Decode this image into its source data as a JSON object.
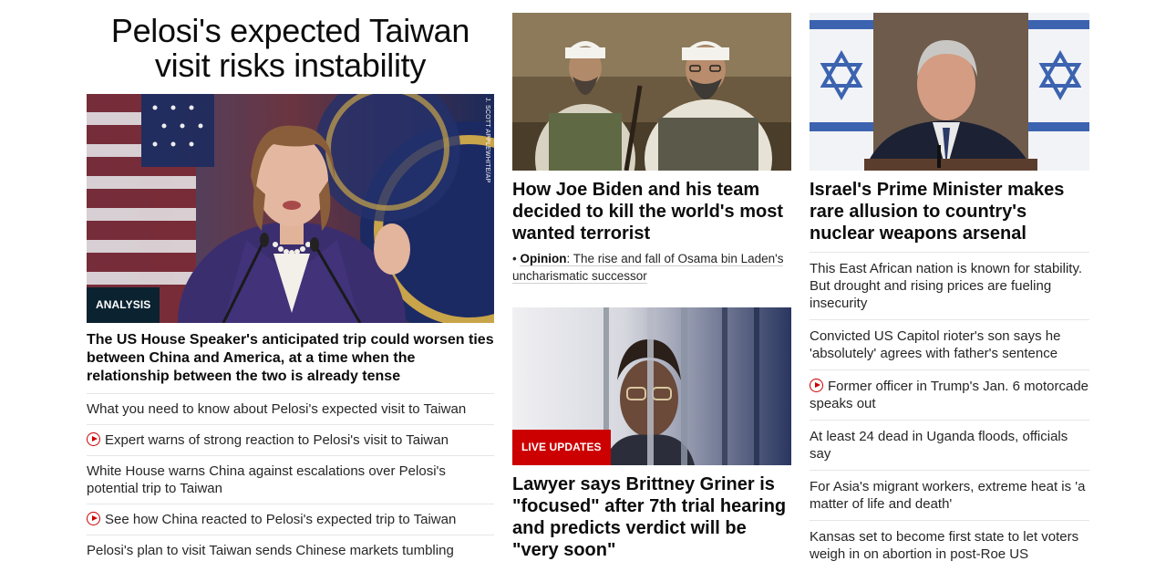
{
  "left": {
    "headline": "Pelosi's expected Taiwan visit risks instability",
    "badge": "ANALYSIS",
    "photo_credit": "J. SCOTT APPLEWHITE/AP",
    "summary": "The US House Speaker's anticipated trip could worsen ties between China and America, at a time when the relationship between the two is already tense",
    "links": [
      {
        "text": "What you need to know about Pelosi's expected visit to Taiwan",
        "video": false
      },
      {
        "text": "Expert warns of strong reaction to Pelosi's visit to Taiwan",
        "video": true
      },
      {
        "text": "White House warns China against escalations over Pelosi's potential trip to Taiwan",
        "video": false
      },
      {
        "text": "See how China reacted to Pelosi's expected trip to Taiwan",
        "video": true
      },
      {
        "text": "Pelosi's plan to visit Taiwan sends Chinese markets tumbling",
        "video": false
      }
    ]
  },
  "middle": {
    "story1": {
      "headline": "How Joe Biden and his team decided to kill the world's most wanted terrorist",
      "opinion_tag": "Opinion",
      "opinion_text": ": The rise and fall of Osama bin Laden's uncharismatic successor"
    },
    "story2": {
      "badge": "LIVE UPDATES",
      "headline": "Lawyer says Brittney Griner is \"focused\" after 7th trial hearing and predicts verdict will be \"very soon\""
    }
  },
  "right": {
    "headline": "Israel's Prime Minister makes rare allusion to country's nuclear weapons arsenal",
    "links": [
      {
        "text": "This East African nation is known for stability. But drought and rising prices are fueling insecurity",
        "video": false
      },
      {
        "text": "Convicted US Capitol rioter's son says he 'absolutely' agrees with father's sentence",
        "video": false
      },
      {
        "text": "Former officer in Trump's Jan. 6 motorcade speaks out",
        "video": true
      },
      {
        "text": "At least 24 dead in Uganda floods, officials say",
        "video": false
      },
      {
        "text": "For Asia's migrant workers, extreme heat is 'a matter of life and death'",
        "video": false
      },
      {
        "text": "Kansas set to become first state to let voters weigh in on abortion in post-Roe US",
        "video": false
      }
    ]
  },
  "colors": {
    "badge_analysis": "#0b2230",
    "badge_live": "#cc0000",
    "video_icon": "#cc0000"
  }
}
